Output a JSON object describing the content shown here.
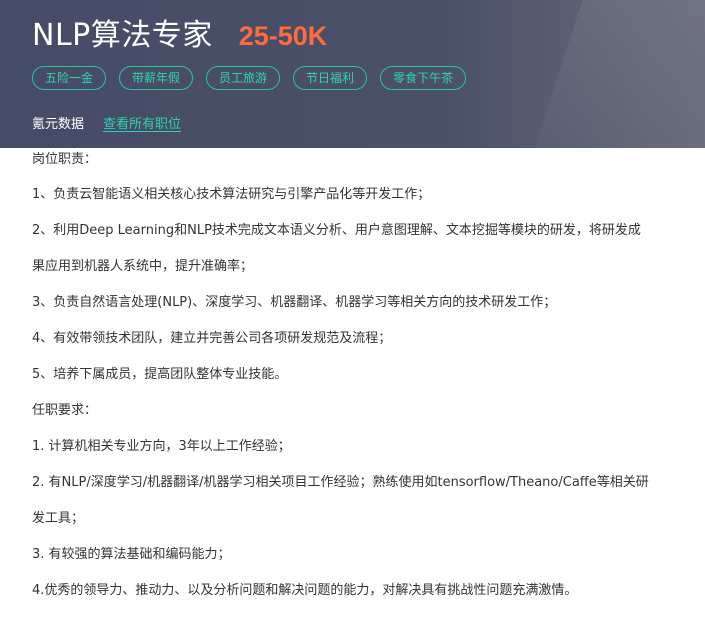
{
  "header": {
    "job_title": "NLP算法专家",
    "salary": "25-50K",
    "tags": [
      "五险一金",
      "带薪年假",
      "员工旅游",
      "节日福利",
      "零食下午茶"
    ],
    "company_name": "氪元数据",
    "all_jobs_link": "查看所有职位"
  },
  "description": {
    "section1_heading": "岗位职责：",
    "duties": [
      "1、负责云智能语义相关核心技术算法研究与引擎产品化等开发工作；",
      "2、利用Deep Learning和NLP技术完成文本语义分析、用户意图理解、文本挖掘等模块的研发，将研发成",
      "果应用到机器人系统中，提升准确率；",
      "3、负责自然语言处理(NLP)、深度学习、机器翻译、机器学习等相关方向的技术研发工作；",
      "4、有效带领技术团队，建立并完善公司各项研发规范及流程；",
      "5、培养下属成员，提高团队整体专业技能。"
    ],
    "section2_heading": "任职要求：",
    "requirements": [
      "1. 计算机相关专业方向，3年以上工作经验；",
      "2. 有NLP/深度学习/机器翻译/机器学习相关项目工作经验；熟练使用如tensorflow/Theano/Caffe等相关研",
      "发工具；",
      "3. 有较强的算法基础和编码能力；",
      "4.优秀的领导力、推动力、以及分析问题和解决问题的能力，对解决具有挑战性问题充满激情。"
    ]
  },
  "colors": {
    "header_bg": "#464c67",
    "salary": "#ff6b3d",
    "accent": "#2fd1ae"
  }
}
